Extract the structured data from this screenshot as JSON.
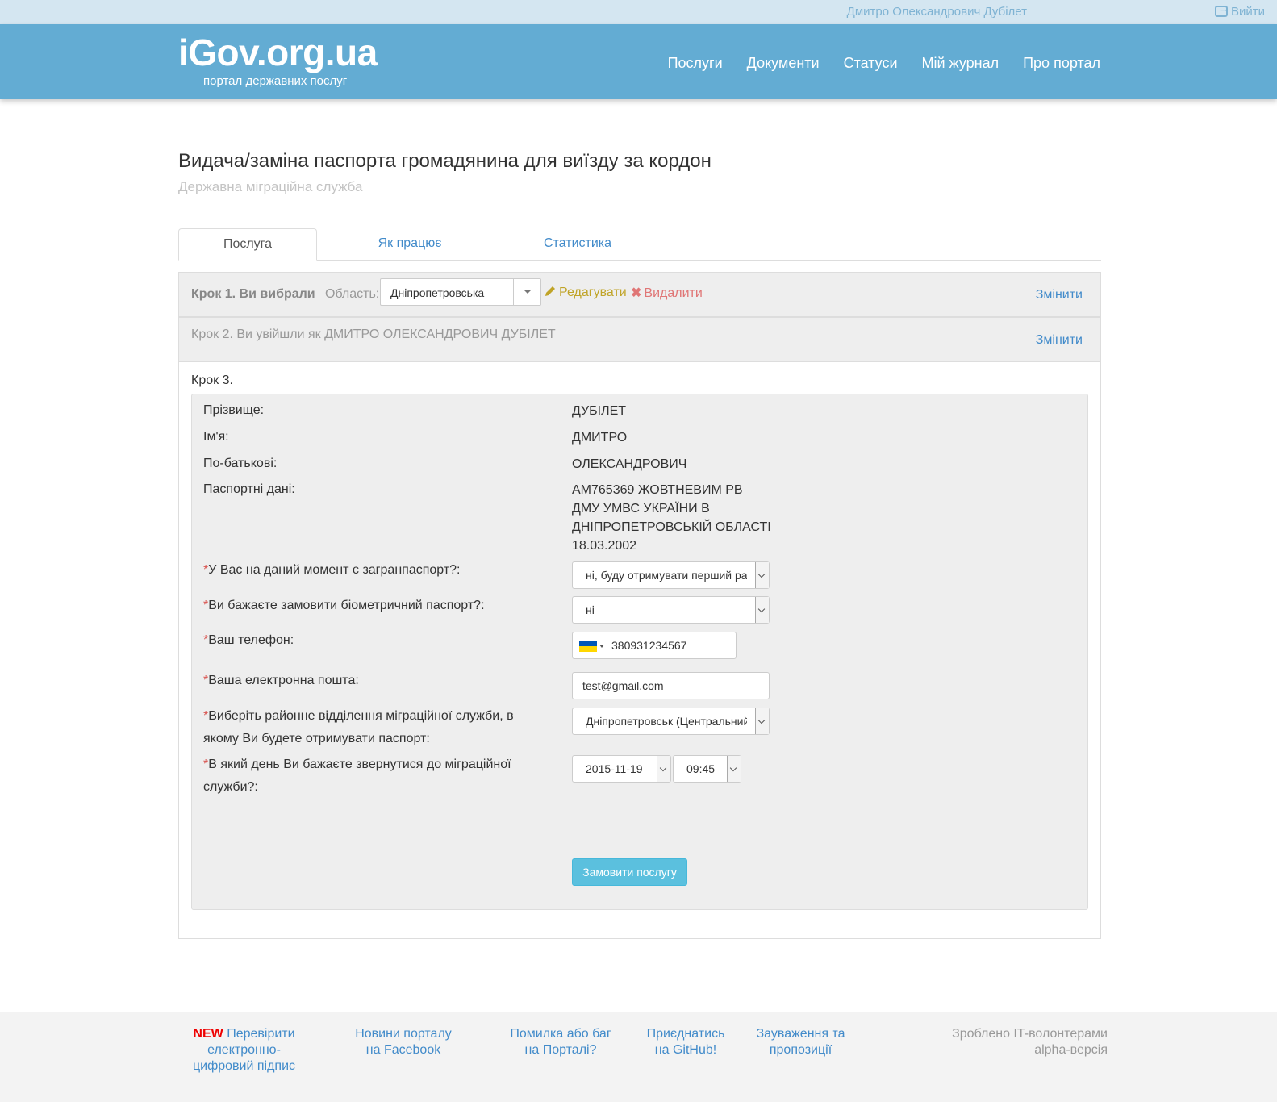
{
  "topbar": {
    "user_name": "Дмитро Олександрович Дубілет",
    "logout": "Вийти"
  },
  "header": {
    "logo": "iGov.org.ua",
    "tagline": "портал державних послуг",
    "nav": [
      "Послуги",
      "Документи",
      "Статуси",
      "Мій журнал",
      "Про портал"
    ]
  },
  "page": {
    "title": "Видача/заміна паспорта громадянина для виїзду за кордон",
    "subtitle": "Державна міграційна служба"
  },
  "tabs": [
    "Послуга",
    "Як працює",
    "Статистика"
  ],
  "step1": {
    "label": "Крок 1. Ви вибрали",
    "region_label": "Область:",
    "region_value": "Дніпропетровська",
    "edit": "Редагувати",
    "delete": "Видалити",
    "change": "Змінити"
  },
  "step2": {
    "label": "Крок 2. Ви увійшли як ДМИТРО ОЛЕКСАНДРОВИЧ ДУБІЛЕТ",
    "change": "Змінити"
  },
  "step3": {
    "label": "Крок 3.",
    "fields": {
      "surname_label": "Прізвище:",
      "surname": "ДУБІЛЕТ",
      "name_label": "Ім'я:",
      "name": "ДМИТРО",
      "patronymic_label": "По-батькові:",
      "patronymic": "ОЛЕКСАНДРОВИЧ",
      "passport_label": "Паспортні дані:",
      "passport_lines": [
        "АМ765369 ЖОВТНЕВИМ РВ",
        "ДМУ УМВС УКРАЇНИ В",
        "ДНІПРОПЕТРОВСЬКІЙ ОБЛАСТІ",
        "18.03.2002"
      ],
      "has_passport_label": "У Вас на даний момент є загранпаспорт?:",
      "has_passport_value": "ні, буду отримувати перший раз",
      "biometric_label": "Ви бажаєте замовити біометричний паспорт?:",
      "biometric_value": "ні",
      "phone_label": "Ваш телефон:",
      "phone_value": "380931234567",
      "email_label": "Ваша електронна пошта:",
      "email_value": "test@gmail.com",
      "office_label_1": "Виберіть районне відділення міграційної служби, в",
      "office_label_2": "якому Ви будете отримувати паспорт:",
      "office_value": "Дніпропетровськ (Центральний",
      "date_label_1": "В який день Ви бажаєте звернутися до міграційної",
      "date_label_2": "служби?:",
      "date_value": "2015-11-19",
      "time_value": "09:45"
    },
    "required_mark": "*",
    "submit": "Замовити послугу"
  },
  "footer": {
    "new_badge": "NEW",
    "col1": [
      "Перевірити",
      "електронно-",
      "цифровий підпис"
    ],
    "col2": [
      "Новини порталу",
      "на Facebook"
    ],
    "col3": [
      "Помилка або баг",
      "на Порталі?"
    ],
    "col4": [
      "Приєднатись",
      "на GitHub!"
    ],
    "col5": [
      "Зауваження та",
      "пропозиції"
    ],
    "right": [
      "Зроблено IT-волонтерами",
      "alpha-версія"
    ]
  },
  "colors": {
    "header": "#63acd3",
    "link": "#428bca",
    "submit": "#5bc0de",
    "required": "#d9534f"
  }
}
